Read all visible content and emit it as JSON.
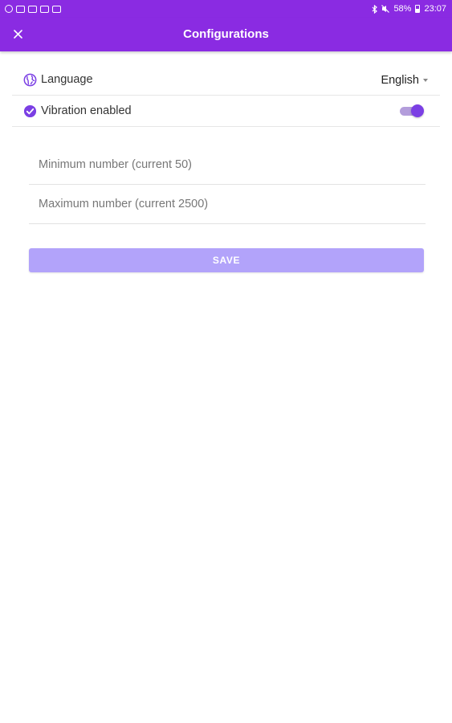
{
  "status_bar": {
    "left_icons": [
      "app-notification-icon",
      "gallery-notification-icon",
      "mail-notification-icon",
      "gallery-notification-icon",
      "image-notification-icon"
    ],
    "right_icons": [
      "bluetooth-icon",
      "mute-icon",
      "battery-icon"
    ],
    "battery": "58%",
    "time": "23:07"
  },
  "header": {
    "title": "Configurations",
    "close_icon": "close-icon"
  },
  "settings": {
    "language": {
      "label": "Language",
      "icon": "globe-icon",
      "value": "English"
    },
    "vibration": {
      "label": "Vibration enabled",
      "icon": "check-circle-icon",
      "enabled": true
    }
  },
  "form": {
    "min_placeholder": "Minimum number (current 50)",
    "max_placeholder": "Maximum number (current 2500)",
    "min_value": "",
    "max_value": "",
    "save_label": "SAVE"
  },
  "colors": {
    "primary": "#8a2be2",
    "accent": "#7b3fe4",
    "save_button": "#b2a3fa",
    "toggle_track": "#b39ddb"
  }
}
